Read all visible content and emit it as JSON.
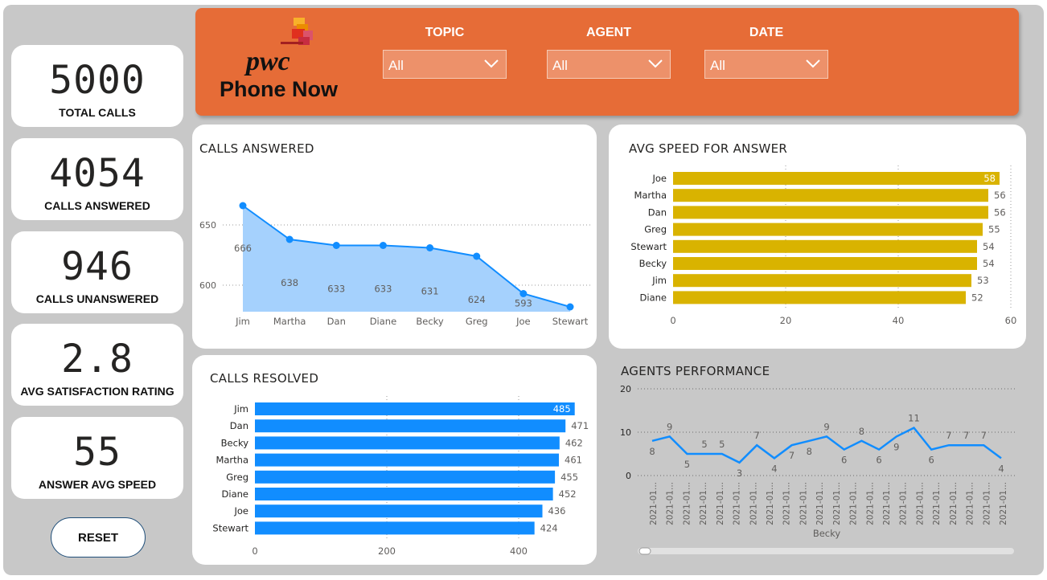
{
  "kpis": [
    {
      "value": "5000",
      "label": "TOTAL CALLS"
    },
    {
      "value": "4054",
      "label": "CALLS ANSWERED"
    },
    {
      "value": "946",
      "label": "CALLS UNANSWERED"
    },
    {
      "value": "2.8",
      "label": "AVG SATISFACTION RATING"
    },
    {
      "value": "55",
      "label": "ANSWER AVG SPEED"
    }
  ],
  "reset_label": "RESET",
  "header": {
    "logo_word": "pwc",
    "app_name": "Phone Now",
    "filters": [
      {
        "title": "TOPIC",
        "value": "All"
      },
      {
        "title": "AGENT",
        "value": "All"
      },
      {
        "title": "DATE",
        "value": "All"
      }
    ]
  },
  "colors": {
    "header": "#e66c37",
    "blue": "#118dff",
    "area_fill": "#a5d1fd",
    "gold": "#d9b300"
  },
  "icons": {
    "filter_dropdown": "chevron-down-icon",
    "slicer_handle": "slider-handle-icon"
  },
  "chart_data": [
    {
      "type": "area",
      "title": "CALLS ANSWERED",
      "categories": [
        "Jim",
        "Martha",
        "Dan",
        "Diane",
        "Becky",
        "Greg",
        "Joe",
        "Stewart"
      ],
      "values": [
        666,
        638,
        633,
        633,
        631,
        624,
        593,
        582
      ],
      "data_labels": [
        "666",
        "638",
        "633",
        "633",
        "631",
        "624",
        "593",
        ""
      ],
      "yticks": [
        600,
        650
      ],
      "ylim": [
        578,
        688
      ],
      "grid": true
    },
    {
      "type": "bar",
      "orientation": "horizontal",
      "title": "AVG SPEED FOR ANSWER",
      "categories": [
        "Joe",
        "Martha",
        "Dan",
        "Greg",
        "Stewart",
        "Becky",
        "Jim",
        "Diane"
      ],
      "values": [
        58,
        56,
        56,
        55,
        54,
        54,
        53,
        52
      ],
      "xticks": [
        0,
        20,
        40,
        60
      ],
      "xlim": [
        0,
        60
      ],
      "grid": true
    },
    {
      "type": "bar",
      "orientation": "horizontal",
      "title": "CALLS RESOLVED",
      "categories": [
        "Jim",
        "Dan",
        "Becky",
        "Martha",
        "Greg",
        "Diane",
        "Joe",
        "Stewart"
      ],
      "values": [
        485,
        471,
        462,
        461,
        455,
        452,
        436,
        424
      ],
      "xticks": [
        0,
        200,
        400
      ],
      "xlim": [
        0,
        500
      ],
      "grid": true
    },
    {
      "type": "line",
      "title": "AGENTS PERFORMANCE",
      "xlabel": "Becky",
      "x": [
        "2021-01...",
        "2021-01...",
        "2021-01...",
        "2021-01...",
        "2021-01...",
        "2021-01...",
        "2021-01...",
        "2021-01...",
        "2021-01...",
        "2021-01...",
        "2021-01...",
        "2021-01...",
        "2021-01...",
        "2021-01...",
        "2021-01...",
        "2021-01...",
        "2021-01...",
        "2021-01...",
        "2021-01...",
        "2021-01...",
        "2021-01...",
        "2021-01..."
      ],
      "values": [
        8,
        9,
        5,
        5,
        5,
        3,
        7,
        4,
        7,
        8,
        9,
        6,
        8,
        6,
        9,
        11,
        6,
        7,
        7,
        7,
        4
      ],
      "yticks": [
        0,
        10,
        20
      ],
      "ylim": [
        0,
        20
      ],
      "grid": true
    }
  ]
}
